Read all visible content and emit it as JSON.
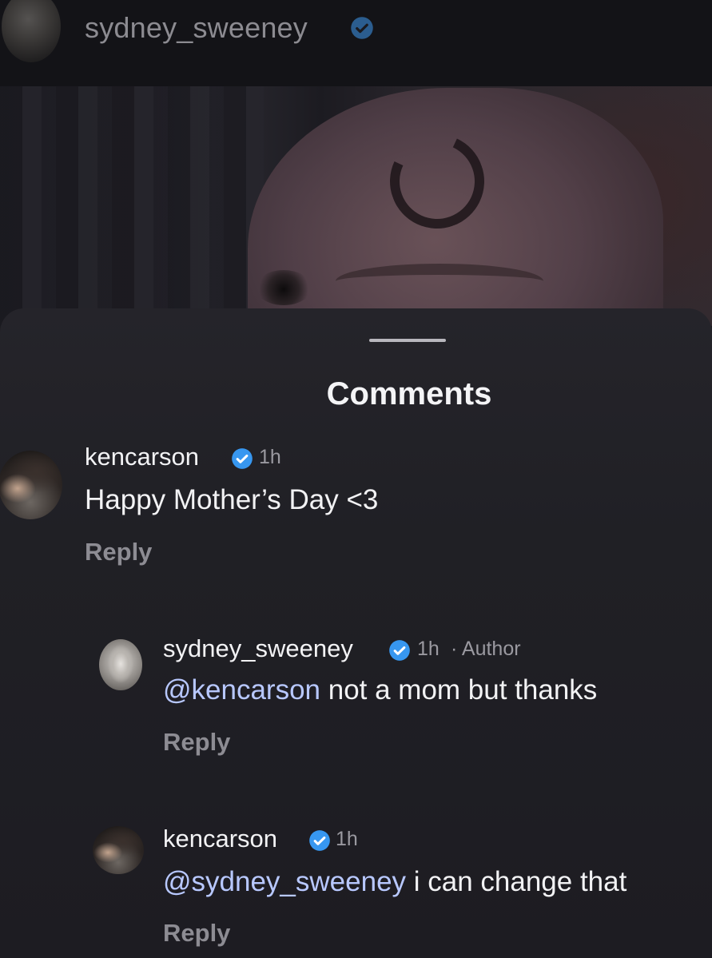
{
  "header": {
    "username": "sydney_sweeney",
    "verified_icon": "verified-badge-icon"
  },
  "sheet": {
    "title": "Comments"
  },
  "comments": [
    {
      "username": "kencarson",
      "time": "1h",
      "text": "Happy Mother’s Day <3",
      "reply_label": "Reply"
    },
    {
      "username": "sydney_sweeney",
      "time": "1h",
      "author_tag": "· Author",
      "mention": "@kencarson",
      "text": " not a mom but thanks",
      "reply_label": "Reply"
    },
    {
      "username": "kencarson",
      "time": "1h",
      "mention": "@sydney_sweeney",
      "text": " i can change that",
      "reply_label": "Reply"
    }
  ],
  "colors": {
    "verified_blue": "#3797f0",
    "mention_color": "#b8c8ff",
    "sheet_background": "#202025"
  }
}
